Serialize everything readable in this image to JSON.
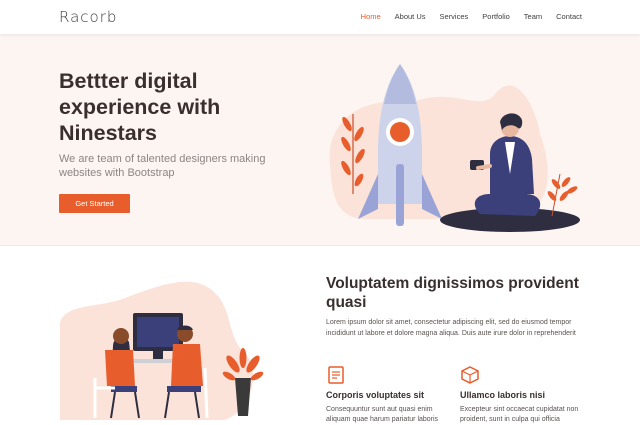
{
  "header": {
    "logo": "Racorb",
    "nav": [
      "Home",
      "About Us",
      "Services",
      "Portfolio",
      "Team",
      "Contact"
    ],
    "active_nav": "Home"
  },
  "hero": {
    "title": "Bettter digital experience with Ninestars",
    "subtitle": "We are team of talented designers making websites with Bootstrap",
    "cta_label": "Get Started"
  },
  "about": {
    "title": "Voluptatem dignissimos provident quasi",
    "text": "Lorem ipsum dolor sit amet, consectetur adipiscing elit, sed do eiusmod tempor incididunt ut labore et dolore magna aliqua. Duis aute irure dolor in reprehenderit",
    "features": [
      {
        "icon": "receipt-icon",
        "title": "Corporis voluptates sit",
        "text": "Consequuntur sunt aut quasi enim aliquam quae harum pariatur laboris"
      },
      {
        "icon": "cube-icon",
        "title": "Ullamco laboris nisi",
        "text": "Excepteur sint occaecat cupidatat non proident, sunt in culpa qui officia"
      }
    ]
  },
  "colors": {
    "accent": "#e85d2c",
    "hero_bg": "#fdf5f2",
    "heading": "#3a2f2f"
  }
}
